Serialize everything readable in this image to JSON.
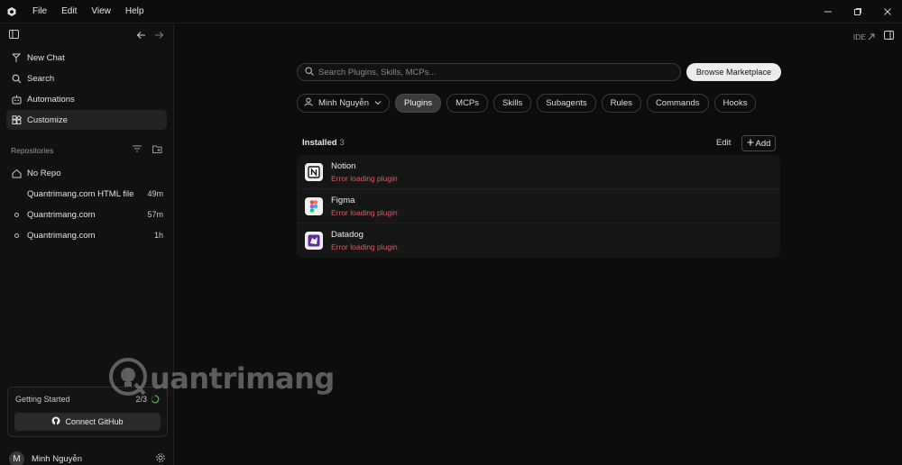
{
  "menu": [
    "File",
    "Edit",
    "View",
    "Help"
  ],
  "sidebar": {
    "nav": [
      {
        "label": "New Chat",
        "icon": "new-chat-icon"
      },
      {
        "label": "Search",
        "icon": "search-icon"
      },
      {
        "label": "Automations",
        "icon": "automations-icon"
      },
      {
        "label": "Customize",
        "icon": "customize-icon",
        "active": true
      }
    ],
    "repositories_label": "Repositories",
    "repos": [
      {
        "label": "No Repo",
        "icon": "home-icon",
        "time": ""
      },
      {
        "label": "Quantrimang.com HTML file",
        "icon": "",
        "time": "49m"
      },
      {
        "label": "Quantrimang.com",
        "icon": "dot-icon",
        "time": "57m"
      },
      {
        "label": "Quantrimang.com",
        "icon": "dot-icon",
        "time": "1h"
      }
    ],
    "getting_started": {
      "title": "Getting Started",
      "progress": "2/3",
      "button": "Connect GitHub"
    },
    "user": {
      "initial": "M",
      "name": "Minh Nguyễn"
    }
  },
  "main": {
    "ide_label": "IDE",
    "search_placeholder": "Search Plugins, Skills, MCPs...",
    "browse_button": "Browse Marketplace",
    "user_filter": "Minh Nguyễn",
    "filters": [
      "Plugins",
      "MCPs",
      "Skills",
      "Subagents",
      "Rules",
      "Commands",
      "Hooks"
    ],
    "active_filter": "Plugins",
    "installed_label": "Installed",
    "installed_count": "3",
    "edit_label": "Edit",
    "add_label": "Add",
    "plugins": [
      {
        "name": "Notion",
        "status": "Error loading plugin",
        "icon": "notion-icon"
      },
      {
        "name": "Figma",
        "status": "Error loading plugin",
        "icon": "figma-icon"
      },
      {
        "name": "Datadog",
        "status": "Error loading plugin",
        "icon": "datadog-icon"
      }
    ]
  },
  "watermark": "uantrimang",
  "colors": {
    "error": "#e05c5c",
    "background": "#0d0d0d",
    "sidebar": "#111111"
  }
}
